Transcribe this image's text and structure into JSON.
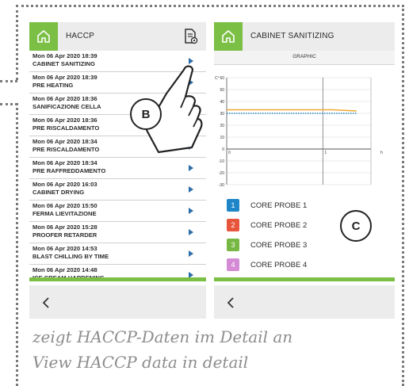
{
  "left_screen": {
    "title": "HACCP",
    "home_icon": "home-icon",
    "doc_icon": "document-settings-icon",
    "back_icon": "chevron-left-icon",
    "rows": [
      {
        "date": "Mon 06 Apr 2020 18:39",
        "name": "CABINET SANITIZING"
      },
      {
        "date": "Mon 06 Apr 2020 18:39",
        "name": "PRE HEATING"
      },
      {
        "date": "Mon 06 Apr 2020 18:36",
        "name": "SANIFICAZIONE CELLA"
      },
      {
        "date": "Mon 06 Apr 2020 18:36",
        "name": "PRE RISCALDAMENTO"
      },
      {
        "date": "Mon 06 Apr 2020 18:34",
        "name": "PRE RISCALDAMENTO"
      },
      {
        "date": "Mon 06 Apr 2020 18:34",
        "name": "PRE RAFFREDDAMENTO"
      },
      {
        "date": "Mon 06 Apr 2020 16:03",
        "name": "CABINET DRYING"
      },
      {
        "date": "Mon 06 Apr 2020 15:50",
        "name": "FERMA LIEVITAZIONE"
      },
      {
        "date": "Mon 06 Apr 2020 15:28",
        "name": "PROOFER RETARDER"
      },
      {
        "date": "Mon 06 Apr 2020 14:53",
        "name": "BLAST CHILLING BY TIME"
      },
      {
        "date": "Mon 06 Apr 2020 14:48",
        "name": "ICE CREAM HARDENING"
      }
    ]
  },
  "right_screen": {
    "title": "CABINET SANITIZING",
    "subtitle": "GRAPHIC",
    "home_icon": "home-icon",
    "back_icon": "chevron-left-icon",
    "probes": [
      {
        "number": "1",
        "label": "CORE PROBE 1",
        "color": "#1e86c8"
      },
      {
        "number": "2",
        "label": "CORE PROBE 2",
        "color": "#e8553d"
      },
      {
        "number": "3",
        "label": "CORE PROBE 3",
        "color": "#76b843"
      },
      {
        "number": "4",
        "label": "CORE PROBE 4",
        "color": "#d58ad6"
      }
    ]
  },
  "chart_data": {
    "type": "line",
    "y_unit": "C°",
    "x_unit": "h",
    "ylim": [
      -30,
      60
    ],
    "yticks": [
      "60",
      "50",
      "40",
      "30",
      "20",
      "10",
      "0",
      "-10",
      "-20",
      "-30"
    ],
    "xlim": [
      0,
      1.5
    ],
    "xticks": [
      "0",
      "1"
    ],
    "grid": true,
    "series": [
      {
        "name": "CORE PROBE 1",
        "color": "#1e86c8",
        "style": "dotted",
        "x": [
          0,
          1.35
        ],
        "y": [
          30,
          30
        ]
      },
      {
        "name": "CORE PROBE 2",
        "color": "#f0a830",
        "style": "solid",
        "x": [
          0,
          1.1,
          1.35
        ],
        "y": [
          33,
          33,
          32
        ]
      }
    ]
  },
  "annotations": {
    "hand_icon": "pointing-hand-icon",
    "marker_b": "B",
    "marker_c": "C"
  },
  "caption": {
    "line1": "zeigt HACCP-Daten im Detail an",
    "line2": "View HACCP data in detail"
  }
}
